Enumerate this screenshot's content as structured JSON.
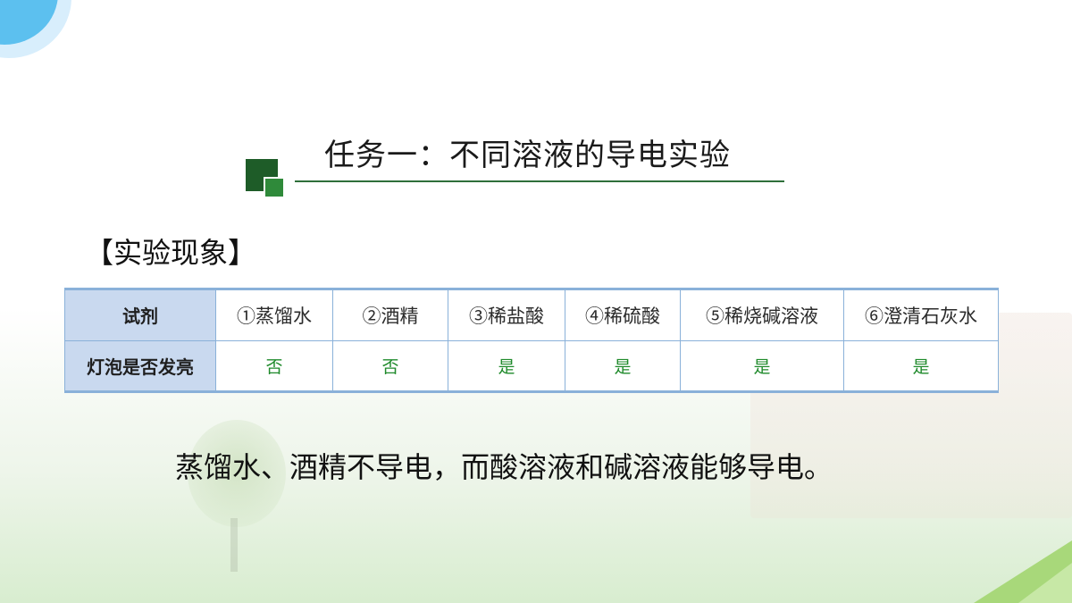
{
  "slide": {
    "title": "任务一：不同溶液的导电实验",
    "section_label": "【实验现象】",
    "conclusion": "蒸馏水、酒精不导电，而酸溶液和碱溶液能够导电。"
  },
  "table": {
    "row_headers": [
      "试剂",
      "灯泡是否发亮"
    ],
    "reagents": [
      "①蒸馏水",
      "②酒精",
      "③稀盐酸",
      "④稀硫酸",
      "⑤稀烧碱溶液",
      "⑥澄清石灰水"
    ],
    "results": [
      "否",
      "否",
      "是",
      "是",
      "是",
      "是"
    ]
  },
  "colors": {
    "accent_dark_green": "#1e5c28",
    "answer_green": "#1f8a2b",
    "table_border_blue": "#8ab1d9",
    "header_fill_blue": "#c9d9ef"
  }
}
